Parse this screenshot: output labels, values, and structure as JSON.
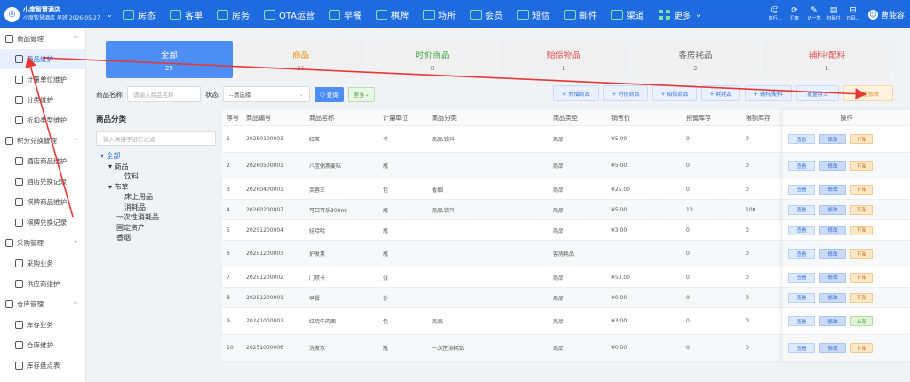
{
  "brand": {
    "name": "小度智慧酒店",
    "subtitle": "小度智慧酒店 早班 2026-05-27"
  },
  "nav": [
    {
      "label": "房态",
      "icon": "room-status-icon"
    },
    {
      "label": "客单",
      "icon": "guest-order-icon"
    },
    {
      "label": "房务",
      "icon": "housekeeping-icon"
    },
    {
      "label": "OTA运营",
      "icon": "ota-icon"
    },
    {
      "label": "早餐",
      "icon": "breakfast-icon"
    },
    {
      "label": "棋牌",
      "icon": "chess-icon"
    },
    {
      "label": "场所",
      "icon": "venue-icon"
    },
    {
      "label": "会员",
      "icon": "member-icon"
    },
    {
      "label": "短信",
      "icon": "sms-icon"
    },
    {
      "label": "邮件",
      "icon": "mail-icon"
    },
    {
      "label": "渠道",
      "icon": "channel-icon"
    },
    {
      "label": "更多",
      "icon": "more-grid-icon"
    }
  ],
  "tools": [
    {
      "glyph": "☺",
      "label": "客行..."
    },
    {
      "glyph": "⟳",
      "label": "汇率"
    },
    {
      "glyph": "✎",
      "label": "记一笔"
    },
    {
      "glyph": "▤",
      "label": "扫码付"
    },
    {
      "glyph": "⊟",
      "label": "扫码..."
    }
  ],
  "user": {
    "name": "曹能容"
  },
  "sidebar": [
    {
      "type": "group",
      "label": "商品管理",
      "name": "sidebar-group-goods"
    },
    {
      "type": "item",
      "label": "商品维护",
      "active": true,
      "name": "sidebar-item-goods-maintain"
    },
    {
      "type": "item",
      "label": "计量单位维护",
      "name": "sidebar-item-unit"
    },
    {
      "type": "item",
      "label": "分类维护",
      "name": "sidebar-item-category"
    },
    {
      "type": "item",
      "label": "折扣类型维护",
      "name": "sidebar-item-discount"
    },
    {
      "type": "group",
      "label": "积分兑换管理",
      "name": "sidebar-group-points"
    },
    {
      "type": "item",
      "label": "酒店商品维护",
      "name": "sidebar-item-hotel-goods"
    },
    {
      "type": "item",
      "label": "酒店兑换记录",
      "name": "sidebar-item-hotel-exchange"
    },
    {
      "type": "item",
      "label": "棋牌商品维护",
      "name": "sidebar-item-chess-goods"
    },
    {
      "type": "item",
      "label": "棋牌兑换记录",
      "name": "sidebar-item-chess-exchange"
    },
    {
      "type": "group",
      "label": "采购管理",
      "name": "sidebar-group-purchase"
    },
    {
      "type": "item",
      "label": "采购业务",
      "name": "sidebar-item-purchase-business"
    },
    {
      "type": "item",
      "label": "供应商维护",
      "name": "sidebar-item-supplier"
    },
    {
      "type": "group",
      "label": "仓库管理",
      "name": "sidebar-group-warehouse"
    },
    {
      "type": "item",
      "label": "库存业务",
      "name": "sidebar-item-stock-business"
    },
    {
      "type": "item",
      "label": "仓库维护",
      "name": "sidebar-item-warehouse"
    },
    {
      "type": "item",
      "label": "库存盘点表",
      "name": "sidebar-item-stocktake"
    }
  ],
  "tabs": [
    {
      "label": "全部",
      "count": "25",
      "active": true,
      "color": "#ffffff"
    },
    {
      "label": "商品",
      "count": "21",
      "color": "#e68a00"
    },
    {
      "label": "时价商品",
      "count": "0",
      "color": "#3aa43a"
    },
    {
      "label": "赔偿物品",
      "count": "1",
      "color": "#e05050"
    },
    {
      "label": "客房耗品",
      "count": "2",
      "color": "#666666"
    },
    {
      "label": "辅料/配料",
      "count": "1",
      "color": "#e05050"
    }
  ],
  "filter": {
    "name_label": "商品名称",
    "name_placeholder": "请输入商品名称",
    "status_label": "状态",
    "status_value": "--请选择",
    "query_label": "查询",
    "more_label": "更多"
  },
  "actions": [
    "+ 新增商品",
    "+ 时价商品",
    "+ 赔偿商品",
    "+ 耗耗品",
    "+ 辅料/配料",
    "批量导入",
    "批量修改"
  ],
  "category": {
    "title": "商品分类",
    "search_placeholder": "输入关键字进行过滤",
    "tree": [
      {
        "label": "▾ 全部",
        "level": 0,
        "root": true
      },
      {
        "label": "▾ 商品",
        "level": 1
      },
      {
        "label": "饮料",
        "level": 3
      },
      {
        "label": "▾ 布草",
        "level": 1
      },
      {
        "label": "床上用品",
        "level": 3
      },
      {
        "label": "消耗品",
        "level": 3
      },
      {
        "label": "一次性消耗品",
        "level": 2
      },
      {
        "label": "固定资产",
        "level": 2
      },
      {
        "label": "香烟",
        "level": 2
      }
    ]
  },
  "table": {
    "headers": [
      "序号",
      "商品编号",
      "商品名称",
      "计量单位",
      "商品分类",
      "商品类型",
      "销售价",
      "预警库存",
      "限额库存"
    ],
    "ops_header": "操作",
    "rows": [
      {
        "cells": [
          "1",
          "20250100003",
          "红茶",
          "个",
          "商品,饮料",
          "商品",
          "¥5.00",
          "0",
          "0"
        ],
        "tall": true,
        "status": "下架"
      },
      {
        "cells": [
          "2",
          "20260500001",
          "八宝粥燕麦味",
          "瓶",
          "",
          "商品",
          "¥5.00",
          "0",
          "0"
        ],
        "tall": true,
        "status": "下架"
      },
      {
        "cells": [
          "3",
          "20260400001",
          "芙蓉王",
          "包",
          "香烟",
          "商品",
          "¥25.00",
          "0",
          "0"
        ],
        "tall": false,
        "status": "下架"
      },
      {
        "cells": [
          "4",
          "20260200007",
          "可口可乐300ml",
          "瓶",
          "商品,饮料",
          "商品",
          "¥5.00",
          "10",
          "100"
        ],
        "tall": false,
        "status": "下架"
      },
      {
        "cells": [
          "5",
          "20251200004",
          "娃哈哈",
          "瓶",
          "",
          "商品",
          "¥3.00",
          "0",
          "0"
        ],
        "tall": false,
        "status": "下架"
      },
      {
        "cells": [
          "6",
          "20251200003",
          "护发素",
          "瓶",
          "",
          "客房耗品",
          "",
          "0",
          "0"
        ],
        "tall": true,
        "status": "下架"
      },
      {
        "cells": [
          "7",
          "20251200002",
          "门禁卡",
          "张",
          "",
          "商品",
          "¥50.00",
          "0",
          "0"
        ],
        "tall": false,
        "status": "下架"
      },
      {
        "cells": [
          "8",
          "20251200001",
          "早餐",
          "份",
          "",
          "商品",
          "¥0.00",
          "0",
          "0"
        ],
        "tall": false,
        "status": "下架"
      },
      {
        "cells": [
          "9",
          "20241000002",
          "红烧牛肉面",
          "包",
          "商品",
          "商品",
          "¥3.00",
          "0",
          "0"
        ],
        "tall": true,
        "status": "上架"
      },
      {
        "cells": [
          "10",
          "20251000006",
          "洗发水",
          "瓶",
          "一次性消耗品",
          "商品",
          "¥0.00",
          "0",
          "0"
        ],
        "tall": true,
        "status": "下架"
      }
    ],
    "op_view": "查看",
    "op_edit": "修改"
  }
}
